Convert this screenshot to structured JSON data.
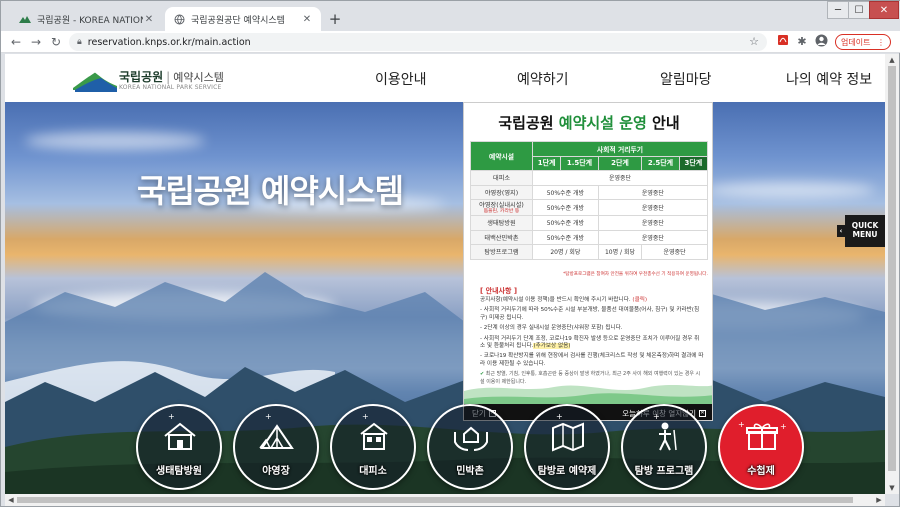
{
  "browser": {
    "tabs": [
      {
        "title": "국립공원 - KOREA NATIONAL PA",
        "favicon": "knps-favicon",
        "active": false
      },
      {
        "title": "국립공원공단 예약시스템",
        "favicon": "globe-icon",
        "active": true
      }
    ],
    "url": "reservation.knps.or.kr/main.action",
    "update_label": "업데이트"
  },
  "site": {
    "logo_name": "국립공원",
    "logo_sep": "|",
    "logo_sys": "예약시스템",
    "logo_eng": "KOREA NATIONAL PARK SERVICE",
    "nav": [
      "이용안내",
      "예약하기",
      "알림마당",
      "나의 예약 정보"
    ]
  },
  "hero": {
    "title": "국립공원 예약시스템"
  },
  "popup": {
    "title_plain": "국립공원 ",
    "title_highlight": "예약시설 운영",
    "title_tail": " 안내",
    "col_facility": "예약시설",
    "col_distancing": "사회적 거리두기",
    "levels": [
      "1단계",
      "1.5단계",
      "2단계",
      "2.5단계",
      "3단계"
    ],
    "rows": [
      {
        "name": "대피소",
        "sub": "",
        "cells": [
          "운영중단"
        ]
      },
      {
        "name": "야영장(영지)",
        "sub": "",
        "cells": [
          "50%수준 개방",
          "운영중단"
        ]
      },
      {
        "name": "야영장(실내시설)",
        "sub": "돔플린, 카라반 등",
        "cells": [
          "50%수준 개방",
          "운영중단"
        ]
      },
      {
        "name": "생태탐방원",
        "sub": "",
        "cells": [
          "50%수준 개방",
          "운영중단"
        ]
      },
      {
        "name": "태백산민박촌",
        "sub": "",
        "cells": [
          "50%수준 개방",
          "운영중단"
        ]
      },
      {
        "name": "탐방프로그램",
        "sub": "",
        "cells": [
          "20명 / 회당",
          "10명 / 회당",
          "운영중단"
        ]
      }
    ],
    "note": "*탐방프로그램은 참여자 안전을 위하여 우천총수선 기 적용하여 운영됩니다.",
    "guide_title": "[ 안내사항 ]",
    "guide_intro": "공지사항(예약시설 이용 정책)을 반드시 확인해 주시기 바랍니다.",
    "guide_intro_link": "(클릭)",
    "guide_1": "- 사회적 거리두기에 따라 50%수준 시설 부분개방, 물품선 대여물품(어사, 침구) 및 카라반(침구) 미제공 됩니다.",
    "guide_2": "- 2단계 이상의 경우 실내시설 운영중단(샤워장 포함) 됩니다.",
    "guide_3a": "- 사회적 거리두기 단계 조정, 코로나19 확진자 발생 등으로 운영중단 조치가 이루어질 경우 취소 및 환불처리 됩니다.",
    "guide_3b": "(추가보상 없음)",
    "guide_4": "- 코로나19 확산방지를 위해 현장에서 검사를 진행(체크리스트 작성 및 체온측정)하며 결과에 따라 이용 제한될 수 있습니다.",
    "guide_5": "최근 방열, 기침, 인후통, 호흡곤란 등 증상이 발생 하였거나, 최근 2주 사이 해외 여행력이 있는 경우 시설 이용이 제한됩니다.",
    "close_label": "닫기",
    "close_today_label": "오늘하루 이창 열지않기"
  },
  "quick_menu": {
    "line1": "QUICK",
    "line2": "MENU"
  },
  "services": [
    {
      "label": "생태탐방원",
      "icon": "house-icon"
    },
    {
      "label": "야영장",
      "icon": "tent-icon"
    },
    {
      "label": "대피소",
      "icon": "shelter-icon"
    },
    {
      "label": "민박촌",
      "icon": "hands-house-icon"
    },
    {
      "label": "탐방로 예약제",
      "icon": "map-icon"
    },
    {
      "label": "탐방 프로그램",
      "icon": "hiker-icon"
    },
    {
      "label": "수첩제",
      "icon": "gift-icon"
    }
  ],
  "colors": {
    "brand_green": "#2e9a43",
    "accent_red": "#e01e2c",
    "update_red": "#d93025"
  }
}
